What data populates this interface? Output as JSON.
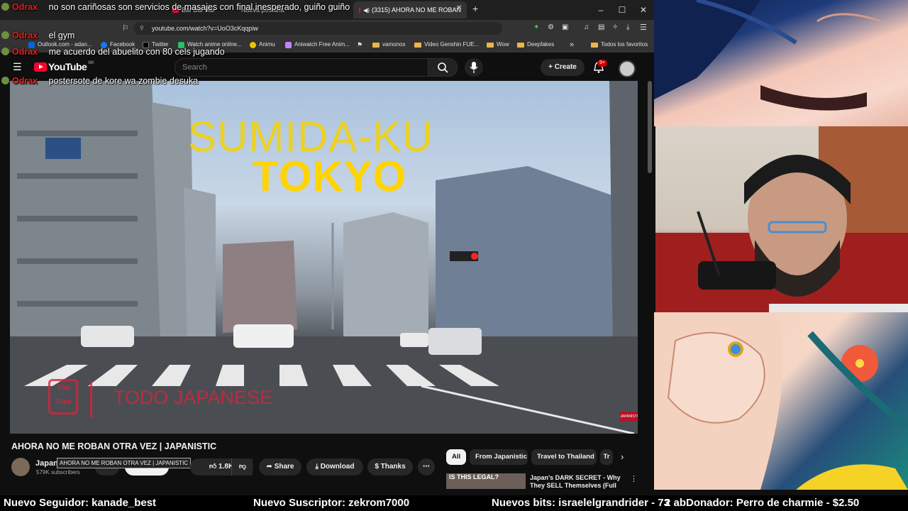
{
  "browser": {
    "tabs": [
      {
        "label": "Bar Bar Bar",
        "active": false
      },
      {
        "label": "Nueva pestaña",
        "active": false
      },
      {
        "label": "(3315) AHORA NO ME ROBAN",
        "active": true
      }
    ],
    "window_controls": {
      "minimize": "–",
      "maximize": "☐",
      "close": "✕"
    },
    "url": "youtube.com/watch?v=UoO3cKqqpiw",
    "bookmarks": [
      {
        "label": "Outlook.com - adan...",
        "icon": "outlook-icon",
        "color": "#0a64d8"
      },
      {
        "label": "Facebook",
        "icon": "facebook-icon",
        "color": "#1877f2"
      },
      {
        "label": "Twitter",
        "icon": "x-icon",
        "color": "#000000"
      },
      {
        "label": "Watch anime online...",
        "icon": "anime-icon",
        "color": "#2bbf6a"
      },
      {
        "label": "Animu",
        "icon": "animu-icon",
        "color": "#f2c200"
      },
      {
        "label": "Aniwatch Free Anim...",
        "icon": "aniwatch-icon",
        "color": "#c084fc"
      },
      {
        "label": "vamonos",
        "icon": "folder-icon",
        "color": "#e8b64b"
      },
      {
        "label": "Video Genshin FUE...",
        "icon": "folder-icon",
        "color": "#e8b64b"
      },
      {
        "label": "Wow",
        "icon": "folder-icon",
        "color": "#e8b64b"
      },
      {
        "label": "Deepfakes",
        "icon": "folder-icon",
        "color": "#e8b64b"
      }
    ],
    "bookmarks_more": "»",
    "all_bookmarks": "Todos los favoritos"
  },
  "youtube": {
    "logo": "YouTube",
    "region": "MX",
    "search_placeholder": "Search",
    "create_label": "Create",
    "notification_count": "9+",
    "video": {
      "overlay_title_1": "SUMIDA-KU",
      "overlay_title_2": "TOKYO",
      "watermark_logo": "You Tube",
      "watermark_text": "TODO JAPANESE",
      "corner_badge": "JAPANISTIC"
    },
    "video_title": "AHORA NO ME ROBAN OTRA VEZ | JAPANISTIC",
    "tooltip": "AHORA NO ME ROBAN OTRA VEZ | JAPANISTIC",
    "channel_name": "Japanistic",
    "subscribers": "579K subscribers",
    "join_label": "Join",
    "subscribe_label": "Subscribe",
    "likes": "1.8K",
    "share_label": "Share",
    "download_label": "Download",
    "thanks_label": "Thanks",
    "more_label": "⋯",
    "chips": [
      "All",
      "From Japanistic",
      "Travel to Thailand",
      "Tr"
    ],
    "recommendation": {
      "thumb_text": "IS THIS LEGAL?",
      "title": "Japan's DARK SECRET - Why They SELL Themselves (Full"
    }
  },
  "chat": [
    {
      "user": "Odrax",
      "message": "no son cariñosas son servicios de masajes con final inesperado, guiño guiño"
    },
    {
      "user": "Odrax",
      "message": "el gym"
    },
    {
      "user": "Odrax",
      "message": "me acuerdo del abuelito con 80 cels jugando"
    },
    {
      "user": "Odrax",
      "message": "postersote de kore wa zombie desuka"
    }
  ],
  "ticker": [
    "Nuevo Seguidor: kanade_best",
    "Nuevo Suscriptor: zekrom7000",
    "Nuevos bits: israelelgrandrider - 73",
    "2 abDonador: Perro de charmie - $2.50"
  ]
}
